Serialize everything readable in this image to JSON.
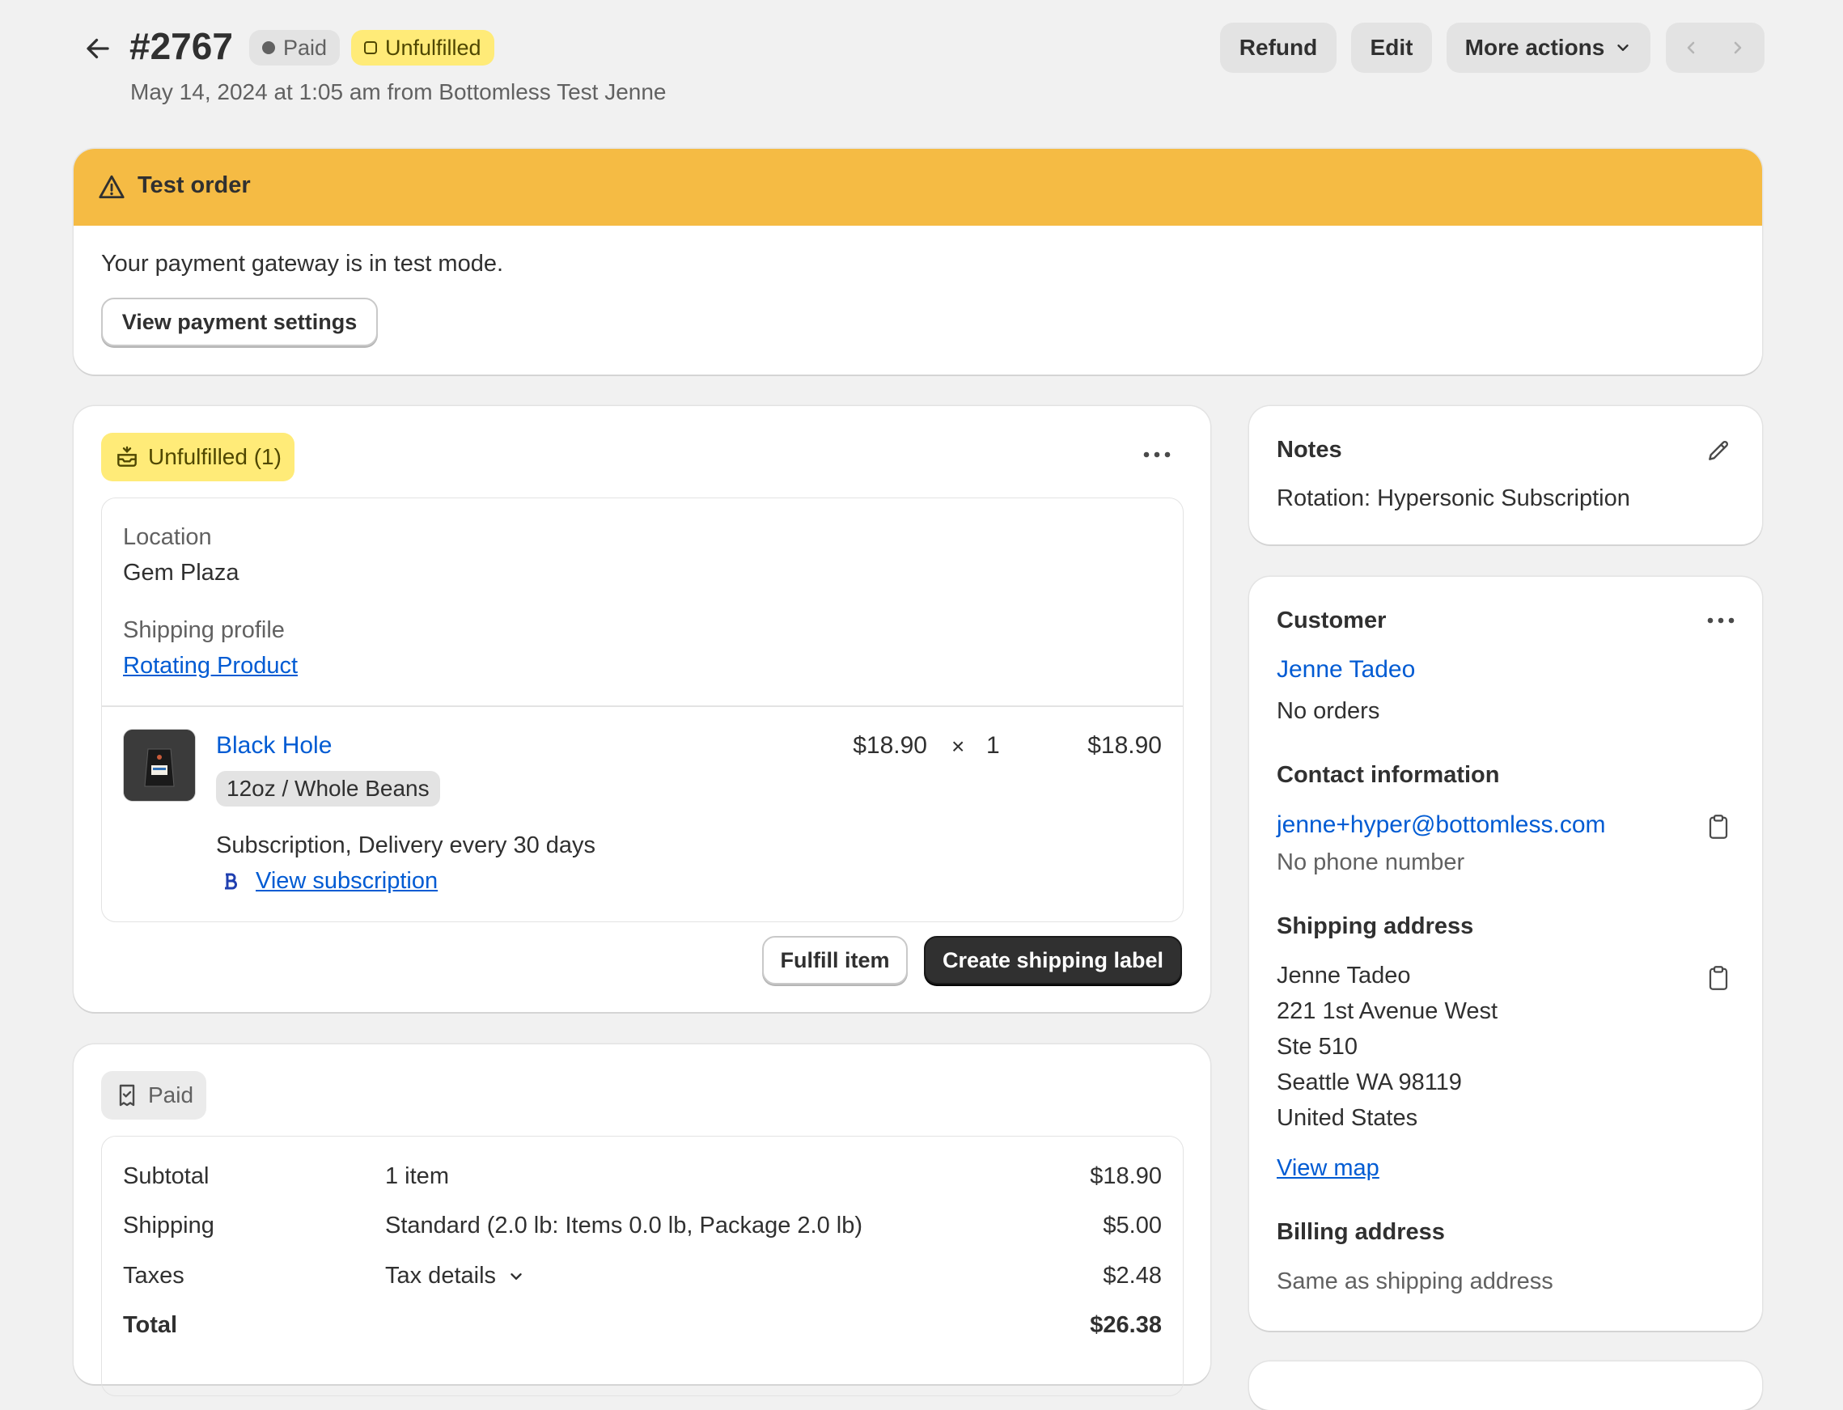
{
  "header": {
    "order_number": "#2767",
    "badge_paid": "Paid",
    "badge_unfulfilled": "Unfulfilled",
    "subtitle": "May 14, 2024 at 1:05 am from Bottomless Test Jenne",
    "refund_label": "Refund",
    "edit_label": "Edit",
    "more_actions_label": "More actions"
  },
  "banner": {
    "title": "Test order",
    "message": "Your payment gateway is in test mode.",
    "button_label": "View payment settings",
    "color": "#f5bb44"
  },
  "fulfillment": {
    "status_label": "Unfulfilled (1)",
    "location_label": "Location",
    "location_value": "Gem Plaza",
    "shipping_profile_label": "Shipping profile",
    "shipping_profile_value": "Rotating Product",
    "item": {
      "name": "Black Hole",
      "variant": "12oz / Whole Beans",
      "unit_price": "$18.90",
      "times": "×",
      "quantity": "1",
      "total": "$18.90",
      "subscription_text": "Subscription, Delivery every 30 days",
      "subscription_link": "View subscription"
    },
    "fulfill_button": "Fulfill item",
    "create_label_button": "Create shipping label"
  },
  "payment": {
    "status_label": "Paid",
    "rows": [
      {
        "label": "Subtotal",
        "detail": "1 item",
        "amount": "$18.90"
      },
      {
        "label": "Shipping",
        "detail": "Standard (2.0 lb: Items 0.0 lb, Package 2.0 lb)",
        "amount": "$5.00"
      },
      {
        "label": "Taxes",
        "detail": "Tax details",
        "amount": "$2.48"
      }
    ],
    "total_label": "Total",
    "total_amount": "$26.38"
  },
  "notes": {
    "title": "Notes",
    "text": "Rotation: Hypersonic Subscription"
  },
  "customer": {
    "title": "Customer",
    "name": "Jenne Tadeo",
    "orders": "No orders",
    "contact_title": "Contact information",
    "email": "jenne+hyper@bottomless.com",
    "phone": "No phone number",
    "shipping_title": "Shipping address",
    "address_lines": [
      "Jenne Tadeo",
      "221 1st Avenue West",
      "Ste 510",
      "Seattle WA 98119",
      "United States"
    ],
    "view_map": "View map",
    "billing_title": "Billing address",
    "billing_text": "Same as shipping address"
  },
  "icons": {
    "back": "arrow-left-icon",
    "warning": "warning-icon",
    "fulfillment": "unfulfilled-box-icon",
    "payment": "receipt-icon",
    "edit": "pencil-icon",
    "copy": "clipboard-icon",
    "menu": "ellipsis-icon",
    "bottomless": "bottomless-logo-icon"
  }
}
